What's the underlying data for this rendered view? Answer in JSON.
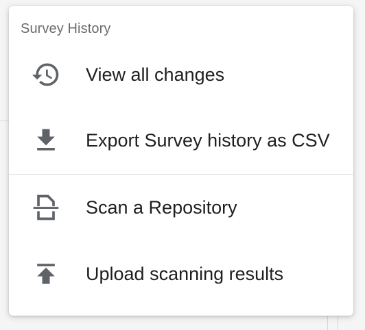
{
  "menu": {
    "header": "Survey History",
    "items": [
      {
        "label": "View all changes",
        "icon": "history-icon"
      },
      {
        "label": "Export Survey history as CSV",
        "icon": "download-icon"
      },
      {
        "label": "Scan a Repository",
        "icon": "document-scanner-icon"
      },
      {
        "label": "Upload scanning results",
        "icon": "upload-icon"
      }
    ]
  },
  "colors": {
    "menu_background": "#ffffff",
    "header_text": "#6b6b6b",
    "item_text": "#1f1f1f",
    "icon": "#5f6368",
    "divider": "#dcdcdc"
  }
}
